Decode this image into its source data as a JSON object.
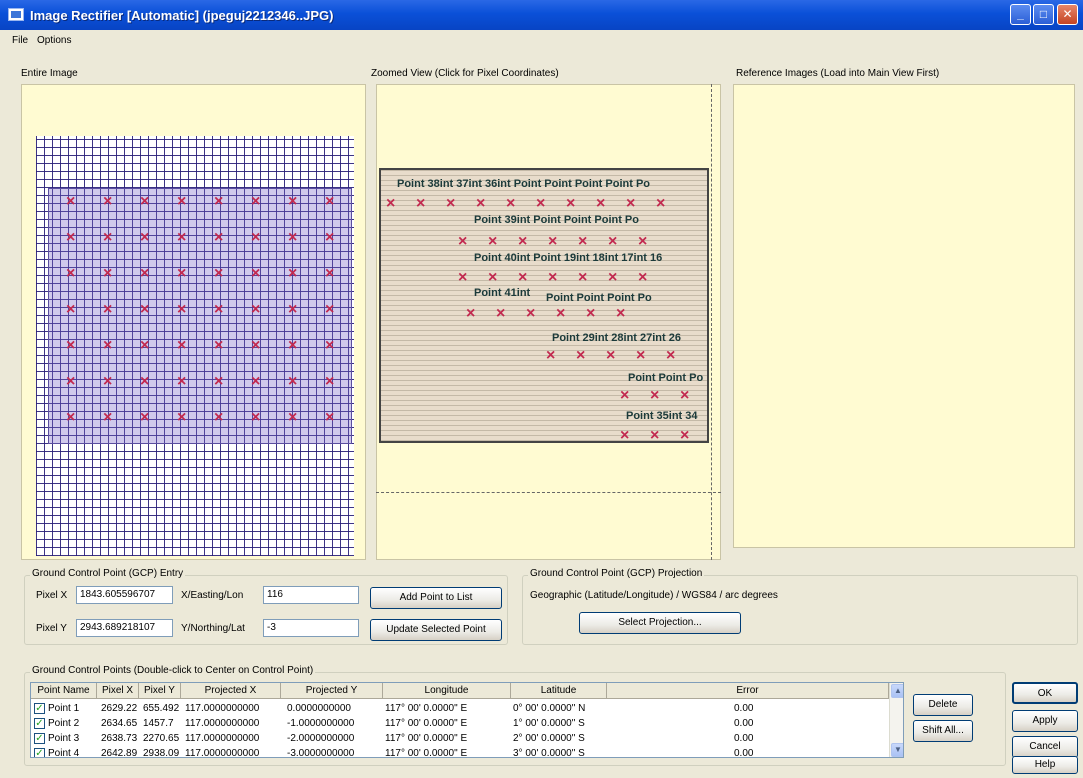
{
  "window": {
    "title": "Image Rectifier [Automatic] (jpeguj2212346..JPG)"
  },
  "menu": {
    "file": "File",
    "options": "Options"
  },
  "panels": {
    "entire_image_label": "Entire Image",
    "zoomed_view_label": "Zoomed View (Click for Pixel Coordinates)",
    "reference_images_label": "Reference Images (Load into Main View First)"
  },
  "zoom_labels": [
    "Point 38int 37int 36int Point Point Point Point Po",
    "Point 39int Point Point Point Po",
    "Point 40int Point 19int 18int 17int 16",
    "Point 41int",
    "Point Point Point Po",
    "Point 29int 28int 27int 26",
    "Point Point Po",
    "Point 35int 34"
  ],
  "gcp_entry": {
    "title": "Ground Control Point (GCP) Entry",
    "pixel_x_label": "Pixel X",
    "pixel_x_value": "1843.605596707",
    "pixel_y_label": "Pixel Y",
    "pixel_y_value": "2943.689218107",
    "x_label": "X/Easting/Lon",
    "x_value": "116",
    "y_label": "Y/Northing/Lat",
    "y_value": "-3",
    "add_button": "Add Point to List",
    "update_button": "Update Selected Point"
  },
  "gcp_projection": {
    "title": "Ground Control Point (GCP) Projection",
    "text": "Geographic (Latitude/Longitude) / WGS84 / arc degrees",
    "select_button": "Select Projection..."
  },
  "gcp_points": {
    "title": "Ground Control Points (Double-click to Center on Control Point)",
    "columns": [
      "Point Name",
      "Pixel X",
      "Pixel Y",
      "Projected X",
      "Projected Y",
      "Longitude",
      "Latitude",
      "Error"
    ],
    "rows": [
      [
        "Point 1",
        "2629.22",
        "655.492",
        "117.0000000000",
        "0.0000000000",
        "117° 00' 0.0000\" E",
        "0° 00' 0.0000\" N",
        "0.00"
      ],
      [
        "Point 2",
        "2634.65",
        "1457.7",
        "117.0000000000",
        "-1.0000000000",
        "117° 00' 0.0000\" E",
        "1° 00' 0.0000\" S",
        "0.00"
      ],
      [
        "Point 3",
        "2638.73",
        "2270.65",
        "117.0000000000",
        "-2.0000000000",
        "117° 00' 0.0000\" E",
        "2° 00' 0.0000\" S",
        "0.00"
      ],
      [
        "Point 4",
        "2642.89",
        "2938.09",
        "117.0000000000",
        "-3.0000000000",
        "117° 00' 0.0000\" E",
        "3° 00' 0.0000\" S",
        "0.00"
      ]
    ]
  },
  "side_buttons": {
    "delete": "Delete",
    "shift_all": "Shift All..."
  },
  "dialog_buttons": {
    "ok": "OK",
    "apply": "Apply",
    "cancel": "Cancel",
    "help": "Help"
  }
}
